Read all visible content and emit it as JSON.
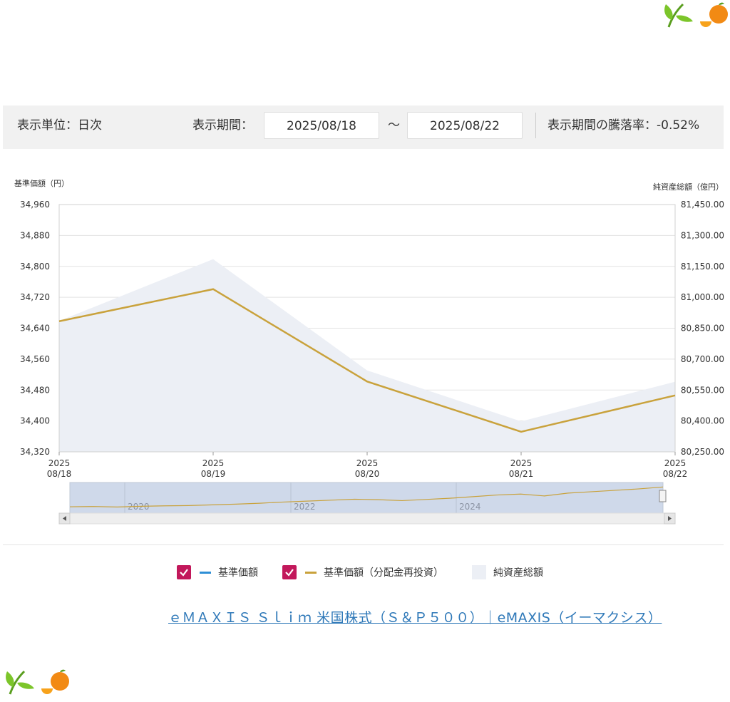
{
  "controls": {
    "unit_label": "表示単位：日次",
    "period_label": "表示期間：",
    "start_date": "2025/08/18",
    "tilde": "～",
    "end_date": "2025/08/22",
    "change_label": "表示期間の騰落率：-0.52%"
  },
  "chart_data": {
    "type": "line",
    "left_axis_title": "基準価額（円）",
    "right_axis_title": "純資産総額（億円）",
    "x_ticks": [
      {
        "year": "2025",
        "date": "08/18"
      },
      {
        "year": "2025",
        "date": "08/19"
      },
      {
        "year": "2025",
        "date": "08/20"
      },
      {
        "year": "2025",
        "date": "08/21"
      },
      {
        "year": "2025",
        "date": "08/22"
      }
    ],
    "left_ticks": [
      "34,960",
      "34,880",
      "34,800",
      "34,720",
      "34,640",
      "34,560",
      "34,480",
      "34,400",
      "34,320"
    ],
    "right_ticks": [
      "81,450.00",
      "81,300.00",
      "81,150.00",
      "81,000.00",
      "80,850.00",
      "80,700.00",
      "80,550.00",
      "80,400.00",
      "80,250.00"
    ],
    "left_ylim": [
      34320,
      34960
    ],
    "right_ylim": [
      80250,
      81450
    ],
    "series": [
      {
        "name": "基準価額（分配金再投資）",
        "axis": "left",
        "color": "#c9a23c",
        "values": [
          34658,
          34741,
          34502,
          34372,
          34466
        ]
      },
      {
        "name": "純資産総額",
        "axis": "right",
        "color": "#eceff5",
        "values": [
          80885,
          81185,
          80645,
          80398,
          80590
        ]
      }
    ],
    "navigator": {
      "year_labels": [
        "2020",
        "2022",
        "2024"
      ],
      "series_color": "#c9a23c",
      "values": [
        0.12,
        0.13,
        0.11,
        0.14,
        0.16,
        0.17,
        0.2,
        0.23,
        0.27,
        0.32,
        0.36,
        0.4,
        0.44,
        0.42,
        0.38,
        0.43,
        0.48,
        0.55,
        0.62,
        0.66,
        0.58,
        0.7,
        0.76,
        0.82,
        0.88,
        0.96
      ]
    }
  },
  "legend": {
    "items": [
      {
        "label": "基準価額",
        "color": "#2e8fd6"
      },
      {
        "label": "基準価額（分配金再投資）",
        "color": "#c9a23c"
      },
      {
        "label": "純資産総額",
        "color": "#eceff5"
      }
    ]
  },
  "footer": {
    "link_text": "ｅＭＡＸＩＳ Ｓｌｉｍ 米国株式（Ｓ＆Ｐ５００）｜eMAXIS（イーマクシス）"
  }
}
